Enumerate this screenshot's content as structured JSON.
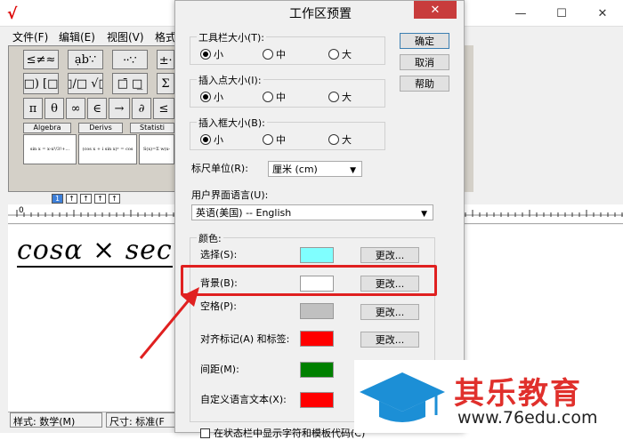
{
  "app": {
    "menu": [
      "文件(F)",
      "编辑(E)",
      "视图(V)",
      "格式"
    ],
    "window_buttons": [
      "—",
      "☐",
      "✕"
    ],
    "palette_row1": [
      "≤≠≈",
      "ạb∵",
      "⸱⸱∵",
      "±⸱"
    ],
    "palette_row2": [
      "(□) [□]",
      "□/□ √□",
      "□̄ □̲",
      "Σ"
    ],
    "palette_row3": [
      "π",
      "θ",
      "∞",
      "∈",
      "→",
      "∂",
      "≤"
    ],
    "palette_tabs": [
      "Algebra",
      "Derivs",
      "Statisti"
    ],
    "templates": [
      "sin x = x-x³/3!+...",
      "(cos x + i sin x)ⁿ = cos",
      "S(x)=Σ w(x-"
    ],
    "tab_scroll": [
      "1",
      "↑",
      "↑",
      "↑",
      "↑"
    ],
    "ruler_zero": "0",
    "equation": "cosα × sec",
    "status_style": "样式: 数学(M)",
    "status_size": "尺寸: 标准(F"
  },
  "dialog": {
    "title": "工作区预置",
    "close": "✕",
    "buttons": {
      "ok": "确定",
      "cancel": "取消",
      "help": "帮助"
    },
    "toolbar_size": {
      "label": "工具栏大小(T):",
      "options": [
        "小",
        "中",
        "大"
      ],
      "selected": "小"
    },
    "insertion_point_size": {
      "label": "插入点大小(I):",
      "options": [
        "小",
        "中",
        "大"
      ],
      "selected": "小"
    },
    "insertion_box_size": {
      "label": "插入框大小(B):",
      "options": [
        "小",
        "中",
        "大"
      ],
      "selected": "小"
    },
    "ruler_unit": {
      "label": "标尺单位(R):",
      "value": "厘米 (cm)"
    },
    "ui_language": {
      "label": "用户界面语言(U):",
      "value": "英语(美国)  --  English"
    },
    "colors": {
      "group_label": "颜色:",
      "change_label": "更改...",
      "items": [
        {
          "label": "选择(S):",
          "color": "#80ffff"
        },
        {
          "label": "背景(B):",
          "color": "#ffffff"
        },
        {
          "label": "空格(P):",
          "color": "#c0c0c0"
        },
        {
          "label": "对齐标记(A) 和标签:",
          "color": "#ff0000"
        },
        {
          "label": "间距(M):",
          "color": "#008000"
        },
        {
          "label": "自定义语言文本(X):",
          "color": "#ff0000"
        }
      ]
    },
    "bottom_checkbox": "在状态栏中显示字符和模板代码(C)"
  },
  "watermark": {
    "brand": "其乐教育",
    "url": "www.76edu.com"
  },
  "highlight_color": "#e02020"
}
